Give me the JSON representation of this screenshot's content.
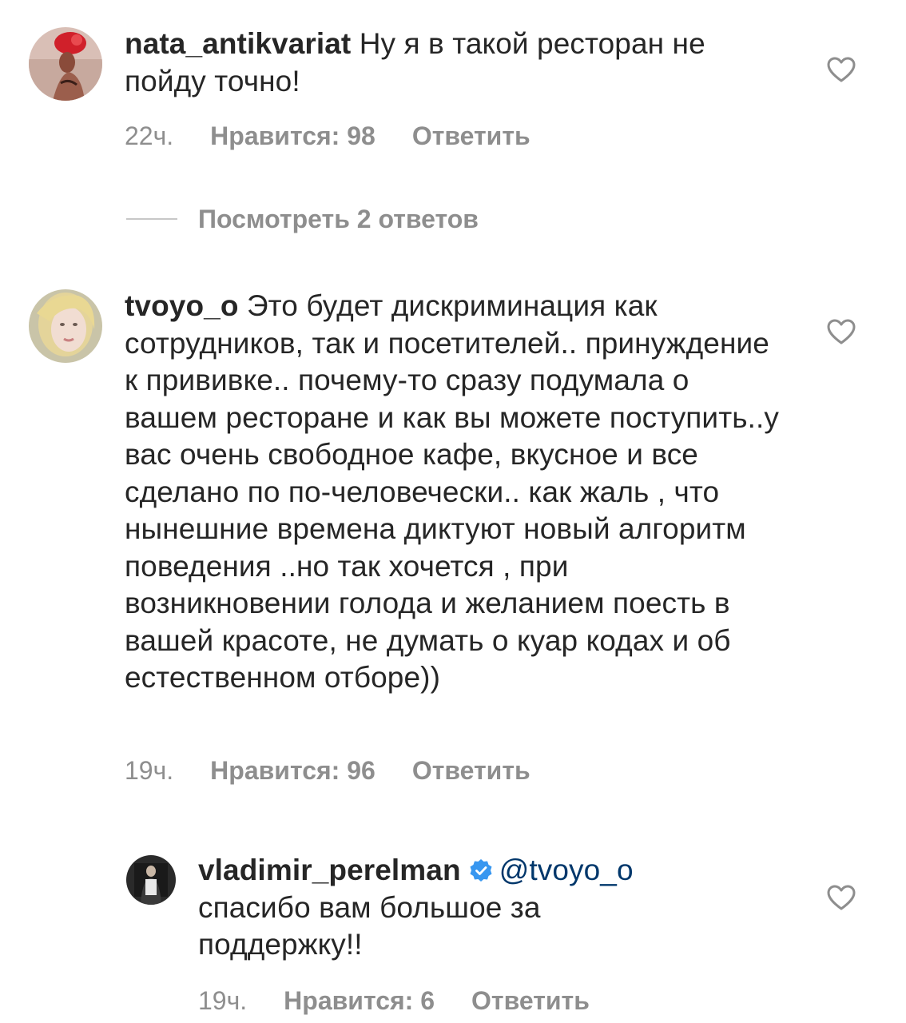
{
  "comments": [
    {
      "username": "nata_antikvariat",
      "text": " Ну я в такой ресторан не пойду точно!",
      "time": "22ч.",
      "likes": "Нравится: 98",
      "reply": "Ответить",
      "avatar_icon": "avatar-red-hat-photo"
    },
    {
      "username": "tvoyo_o",
      "text": " Это будет дискриминация как сотрудников, так и посетителей.. принуждение к прививке.. почему-то сразу подумала о вашем ресторане и как вы можете поступить..у вас очень свободное кафе, вкусное  и  все сделано по по-человечески.. как жаль , что нынешние времена диктуют новый алгоритм поведения ..но так хочется , при возникновении голода и желанием поесть в вашей красоте, не думать о куар кодах и об естественном отборе))",
      "time": "19ч.",
      "likes": "Нравится: 96",
      "reply": "Ответить",
      "avatar_icon": "avatar-blonde-woman-photo"
    },
    {
      "username": "vladimir_perelman",
      "mention": "@tvoyo_o",
      "text": "спасибо вам большое за поддержку!!",
      "time": "19ч.",
      "likes": "Нравится: 6",
      "reply": "Ответить",
      "avatar_icon": "avatar-man-photo",
      "verified": true
    }
  ],
  "view_replies": "Посмотреть 2 ответов",
  "colors": {
    "text": "#262626",
    "secondary": "#8e8e8e",
    "mention": "#00376b",
    "verified": "#3897f0"
  }
}
